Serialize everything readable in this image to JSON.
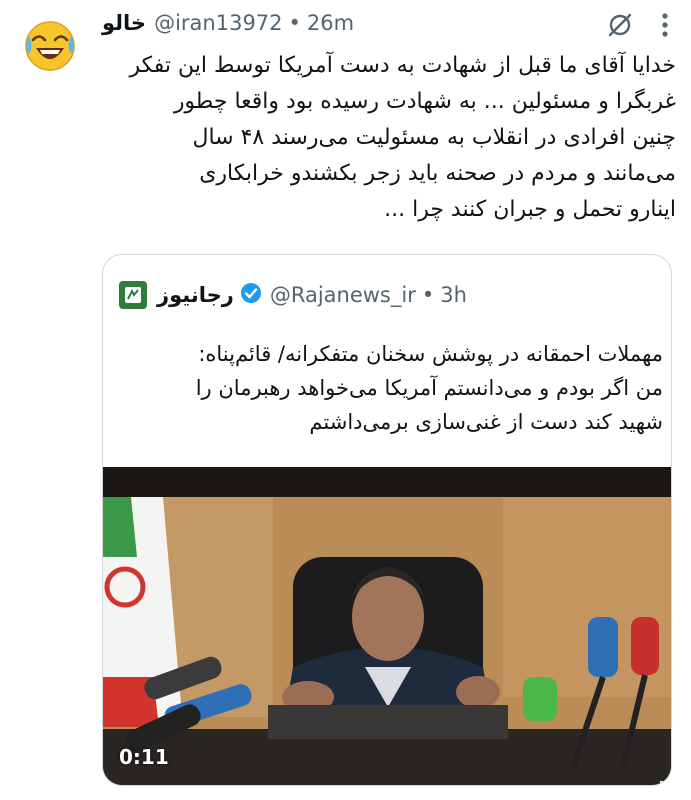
{
  "tweet": {
    "display_name": "خالو",
    "handle": "@iran13972",
    "separator": "•",
    "time": "26m",
    "avatar_icon": "laughing-emoji-icon",
    "text_lines": [
      "خدایا آقای ما قبل از شهادت به دست آمریکا توسط این تفکر",
      "غربگرا و مسئولین ... به شهادت رسیده بود واقعا چطور",
      "چنین افرادی در انقلاب به مسئولیت می‌رسند ۴۸ سال",
      "می‌مانند و مردم در صحنه باید  زجر بکشندو خرابکاری",
      "اینارو تحمل و جبران کنند چرا ..."
    ]
  },
  "icons": {
    "grok": "grok-icon",
    "more": "more-options-icon"
  },
  "quote": {
    "display_name": "رجانیوز",
    "handle": "@Rajanews_ir",
    "separator": "•",
    "time": "3h",
    "logo_icon": "rajanews-logo-icon",
    "verified_icon": "verified-badge-icon",
    "verified_color": "#1d9bf0",
    "text_lines": [
      "مهملات احمقانه در پوشش سخنان متفکرانه/ قائم‌پناه:",
      "من اگر بودم و می‌دانستم آمریکا می‌خواهد رهبرمان را",
      "شهید کند دست از غنی‌سازی برمی‌داشتم"
    ],
    "video": {
      "duration": "0:11",
      "mute_icon": "muted-speaker-icon"
    }
  },
  "colors": {
    "text": "#0f1419",
    "secondary": "#536471",
    "border": "#cfd9de"
  }
}
